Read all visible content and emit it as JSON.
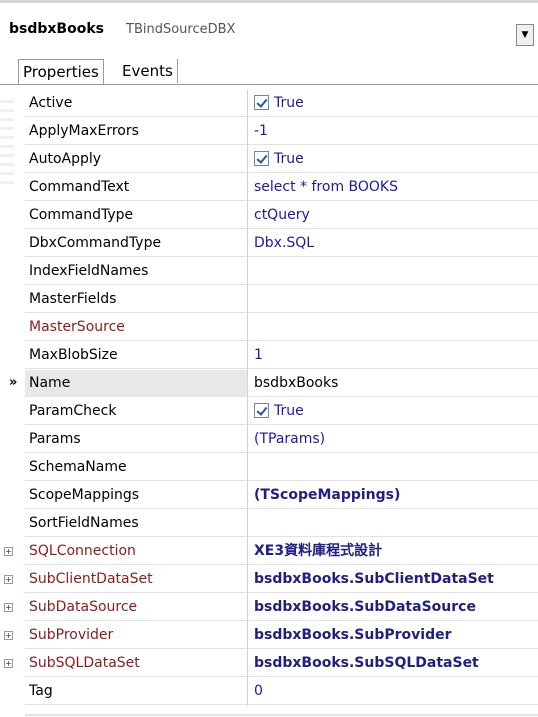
{
  "header": {
    "component_name": "bsdbxBooks",
    "component_type": "TBindSourceDBX",
    "dropdown_icon": "chevron-down-icon"
  },
  "tabs": [
    {
      "label": "Properties",
      "active": true
    },
    {
      "label": "Events",
      "active": false
    }
  ],
  "properties": [
    {
      "name": "Active",
      "value": "True",
      "checkbox": true,
      "checked": true,
      "name_color": "normal",
      "value_style": "normal",
      "expandable": false,
      "selected": false
    },
    {
      "name": "ApplyMaxErrors",
      "value": "-1",
      "checkbox": false,
      "name_color": "normal",
      "value_style": "normal",
      "expandable": false,
      "selected": false
    },
    {
      "name": "AutoApply",
      "value": "True",
      "checkbox": true,
      "checked": true,
      "name_color": "normal",
      "value_style": "normal",
      "expandable": false,
      "selected": false
    },
    {
      "name": "CommandText",
      "value": "select * from BOOKS",
      "checkbox": false,
      "name_color": "normal",
      "value_style": "normal",
      "expandable": false,
      "selected": false
    },
    {
      "name": "CommandType",
      "value": "ctQuery",
      "checkbox": false,
      "name_color": "normal",
      "value_style": "normal",
      "expandable": false,
      "selected": false
    },
    {
      "name": "DbxCommandType",
      "value": "Dbx.SQL",
      "checkbox": false,
      "name_color": "normal",
      "value_style": "normal",
      "expandable": false,
      "selected": false
    },
    {
      "name": "IndexFieldNames",
      "value": "",
      "checkbox": false,
      "name_color": "normal",
      "value_style": "normal",
      "expandable": false,
      "selected": false
    },
    {
      "name": "MasterFields",
      "value": "",
      "checkbox": false,
      "name_color": "normal",
      "value_style": "normal",
      "expandable": false,
      "selected": false
    },
    {
      "name": "MasterSource",
      "value": "",
      "checkbox": false,
      "name_color": "red",
      "value_style": "normal",
      "expandable": false,
      "selected": false
    },
    {
      "name": "MaxBlobSize",
      "value": "1",
      "checkbox": false,
      "name_color": "normal",
      "value_style": "normal",
      "expandable": false,
      "selected": false
    },
    {
      "name": "Name",
      "value": "bsdbxBooks",
      "checkbox": false,
      "name_color": "normal",
      "value_style": "dark",
      "expandable": false,
      "selected": true,
      "marker": "»"
    },
    {
      "name": "ParamCheck",
      "value": "True",
      "checkbox": true,
      "checked": true,
      "name_color": "normal",
      "value_style": "normal",
      "expandable": false,
      "selected": false
    },
    {
      "name": "Params",
      "value": "(TParams)",
      "checkbox": false,
      "name_color": "normal",
      "value_style": "normal",
      "expandable": false,
      "selected": false
    },
    {
      "name": "SchemaName",
      "value": "",
      "checkbox": false,
      "name_color": "normal",
      "value_style": "normal",
      "expandable": false,
      "selected": false
    },
    {
      "name": "ScopeMappings",
      "value": "(TScopeMappings)",
      "checkbox": false,
      "name_color": "normal",
      "value_style": "bold",
      "expandable": false,
      "selected": false
    },
    {
      "name": "SortFieldNames",
      "value": "",
      "checkbox": false,
      "name_color": "normal",
      "value_style": "normal",
      "expandable": false,
      "selected": false
    },
    {
      "name": "SQLConnection",
      "value": "XE3資料庫程式設計",
      "checkbox": false,
      "name_color": "red",
      "value_style": "bold",
      "expandable": true,
      "selected": false
    },
    {
      "name": "SubClientDataSet",
      "value": "bsdbxBooks.SubClientDataSet",
      "checkbox": false,
      "name_color": "red",
      "value_style": "bold",
      "expandable": true,
      "selected": false
    },
    {
      "name": "SubDataSource",
      "value": "bsdbxBooks.SubDataSource",
      "checkbox": false,
      "name_color": "red",
      "value_style": "bold",
      "expandable": true,
      "selected": false
    },
    {
      "name": "SubProvider",
      "value": "bsdbxBooks.SubProvider",
      "checkbox": false,
      "name_color": "red",
      "value_style": "bold",
      "expandable": true,
      "selected": false
    },
    {
      "name": "SubSQLDataSet",
      "value": "bsdbxBooks.SubSQLDataSet",
      "checkbox": false,
      "name_color": "red",
      "value_style": "bold",
      "expandable": true,
      "selected": false
    },
    {
      "name": "Tag",
      "value": "0",
      "checkbox": false,
      "name_color": "normal",
      "value_style": "normal",
      "expandable": false,
      "selected": false
    }
  ]
}
